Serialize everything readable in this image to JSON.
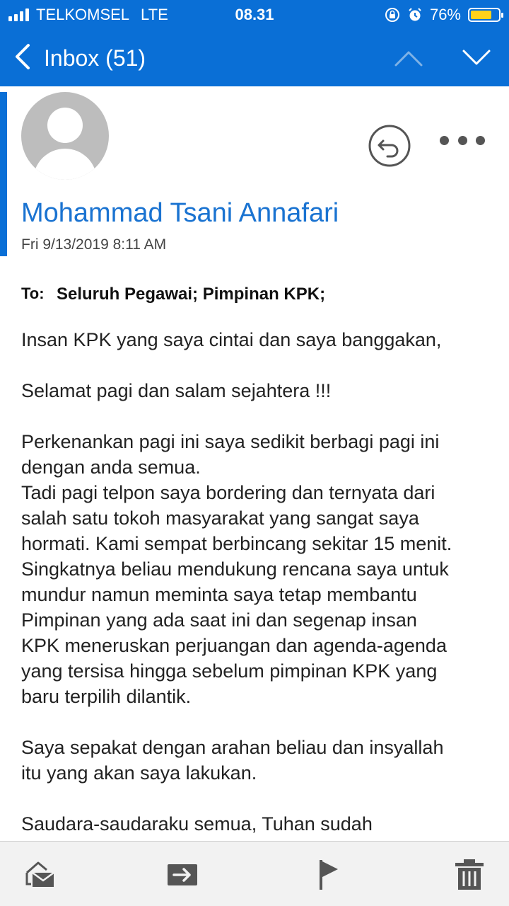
{
  "status_bar": {
    "carrier": "TELKOMSEL",
    "network": "LTE",
    "time": "08.31",
    "battery": "76%",
    "battery_level": 0.76
  },
  "nav": {
    "back_label": "Inbox (51)"
  },
  "email": {
    "sender": "Mohammad Tsani Annafari",
    "date": "Fri 9/13/2019 8:11 AM",
    "to_label": "To:",
    "to_value": "Seluruh Pegawai; Pimpinan KPK;",
    "paragraphs": [
      "Insan KPK yang saya cintai dan saya banggakan,",
      "Selamat pagi dan salam sejahtera !!!",
      "Perkenankan pagi ini saya sedikit berbagi pagi ini\ndengan anda semua.\nTadi pagi telpon saya bordering dan ternyata dari\nsalah satu tokoh masyarakat yang sangat saya\nhormati. Kami sempat berbincang sekitar 15 menit.\nSingkatnya beliau mendukung rencana saya untuk\nmundur namun meminta saya tetap membantu\nPimpinan yang ada saat ini dan segenap insan\nKPK meneruskan perjuangan dan agenda-agenda\nyang tersisa hingga sebelum pimpinan KPK yang\nbaru terpilih dilantik.",
      "Saya sepakat dengan arahan beliau dan insyallah\nitu yang akan saya lakukan.",
      "Saudara-saudaraku semua, Tuhan sudah"
    ]
  },
  "icons": {
    "back": "chevron-left-icon",
    "prev": "chevron-up-icon",
    "next": "chevron-down-icon",
    "reply": "reply-icon",
    "more": "more-icon",
    "mark_read": "mail-open-icon",
    "move": "move-icon",
    "flag": "flag-icon",
    "delete": "trash-icon"
  },
  "colors": {
    "header": "#0a6fd6",
    "sender": "#1a73d1",
    "battery": "#ffd21a"
  }
}
